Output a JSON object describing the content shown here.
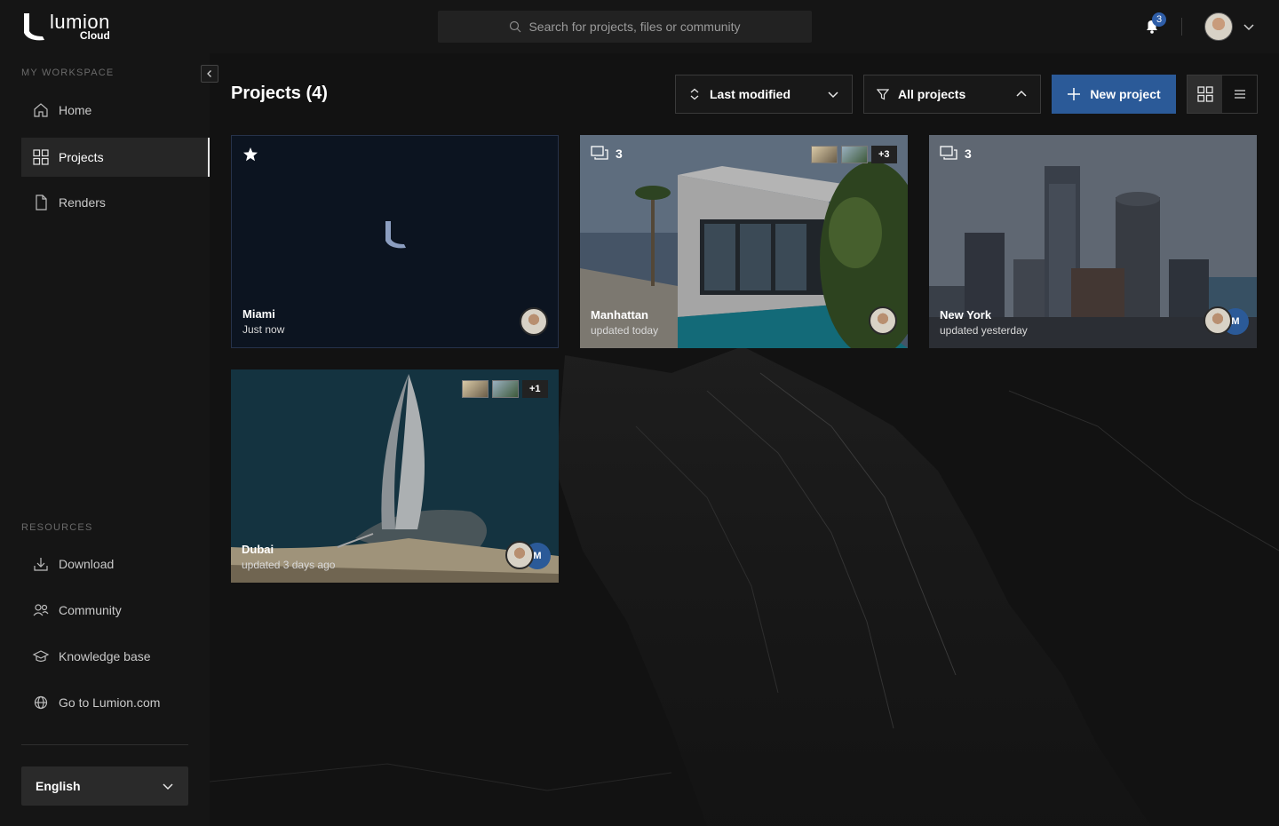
{
  "app": {
    "logo_text": "lumion",
    "logo_sub": "Cloud"
  },
  "search": {
    "placeholder": "Search for projects, files or community"
  },
  "notifications": {
    "count": "3"
  },
  "sidebar": {
    "workspace_title": "MY WORKSPACE",
    "items": [
      {
        "label": "Home",
        "icon": "home-icon"
      },
      {
        "label": "Projects",
        "icon": "grid-icon",
        "active": true
      },
      {
        "label": "Renders",
        "icon": "file-icon"
      }
    ],
    "resources_title": "RESOURCES",
    "resources": [
      {
        "label": "Download",
        "icon": "download-icon"
      },
      {
        "label": "Community",
        "icon": "people-icon"
      },
      {
        "label": "Knowledge base",
        "icon": "graduation-icon"
      },
      {
        "label": "Go to Lumion.com",
        "icon": "globe-icon"
      }
    ],
    "language": "English"
  },
  "main": {
    "title": "Projects (4)",
    "sort_label": "Last modified",
    "filter_label": "All projects",
    "new_project_label": "New project",
    "view_mode": "grid"
  },
  "projects": [
    {
      "name": "Miami",
      "updated": "Just now",
      "starred": true,
      "comments": "",
      "extra_images": "",
      "members": ""
    },
    {
      "name": "Manhattan",
      "updated": "updated today",
      "starred": false,
      "comments": "3",
      "extra_images": "+3",
      "members": ""
    },
    {
      "name": "New York",
      "updated": "updated yesterday",
      "starred": false,
      "comments": "3",
      "extra_images": "",
      "members": "M"
    },
    {
      "name": "Dubai",
      "updated": "updated 3 days ago",
      "starred": false,
      "comments": "",
      "extra_images": "+1",
      "members": "M"
    }
  ],
  "colors": {
    "accent": "#2b5a98",
    "background": "#121212",
    "sidebar": "#151515"
  }
}
